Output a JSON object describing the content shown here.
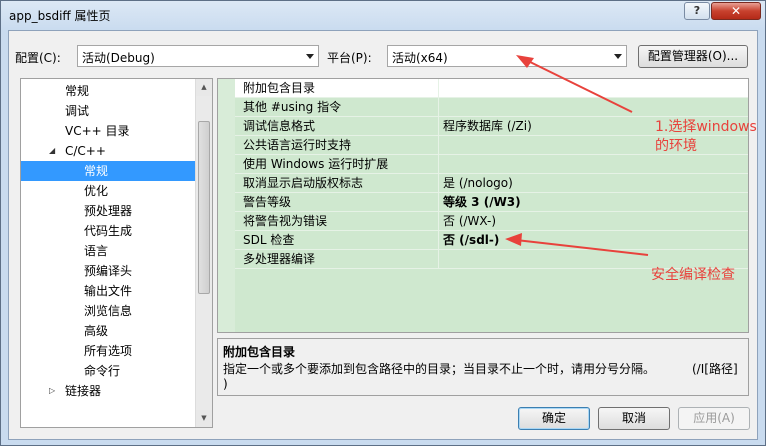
{
  "window": {
    "title": "app_bsdiff 属性页",
    "help_label": "?",
    "close_label": "✕"
  },
  "toolbar": {
    "config_label": "配置(C):",
    "config_value": "活动(Debug)",
    "platform_label": "平台(P):",
    "platform_value": "活动(x64)",
    "config_manager_label": "配置管理器(O)..."
  },
  "tree": {
    "items": [
      {
        "label": "常规"
      },
      {
        "label": "调试"
      },
      {
        "label": "VC++ 目录"
      },
      {
        "label": "C/C++",
        "expanded": true
      },
      {
        "label": "常规",
        "selected": true
      },
      {
        "label": "优化"
      },
      {
        "label": "预处理器"
      },
      {
        "label": "代码生成"
      },
      {
        "label": "语言"
      },
      {
        "label": "预编译头"
      },
      {
        "label": "输出文件"
      },
      {
        "label": "浏览信息"
      },
      {
        "label": "高级"
      },
      {
        "label": "所有选项"
      },
      {
        "label": "命令行"
      },
      {
        "label": "链接器",
        "expanded": false
      }
    ]
  },
  "grid": {
    "rows": [
      {
        "name": "附加包含目录",
        "value": "",
        "bold": false,
        "selected": true
      },
      {
        "name": "其他 #using 指令",
        "value": "",
        "bold": false
      },
      {
        "name": "调试信息格式",
        "value": "程序数据库 (/Zi)",
        "bold": false
      },
      {
        "name": "公共语言运行时支持",
        "value": "",
        "bold": false
      },
      {
        "name": "使用 Windows 运行时扩展",
        "value": "",
        "bold": false
      },
      {
        "name": "取消显示启动版权标志",
        "value": "是 (/nologo)",
        "bold": false
      },
      {
        "name": "警告等级",
        "value": "等级 3 (/W3)",
        "bold": true
      },
      {
        "name": "将警告视为错误",
        "value": "否 (/WX-)",
        "bold": false
      },
      {
        "name": "SDL 检查",
        "value": "否 (/sdl-)",
        "bold": true
      },
      {
        "name": "多处理器编译",
        "value": "",
        "bold": false
      }
    ]
  },
  "description": {
    "title": "附加包含目录",
    "text": "指定一个或多个要添加到包含路径中的目录；当目录不止一个时，请用分号分隔。",
    "text_tail": "(/I[路径]",
    "text_line2": ")"
  },
  "buttons": {
    "ok": "确定",
    "cancel": "取消",
    "apply": "应用(A)"
  },
  "annotations": {
    "note1": "1.选择windows",
    "note1b": "的环境",
    "note2": "安全编译检查",
    "color": "#e8423c"
  }
}
